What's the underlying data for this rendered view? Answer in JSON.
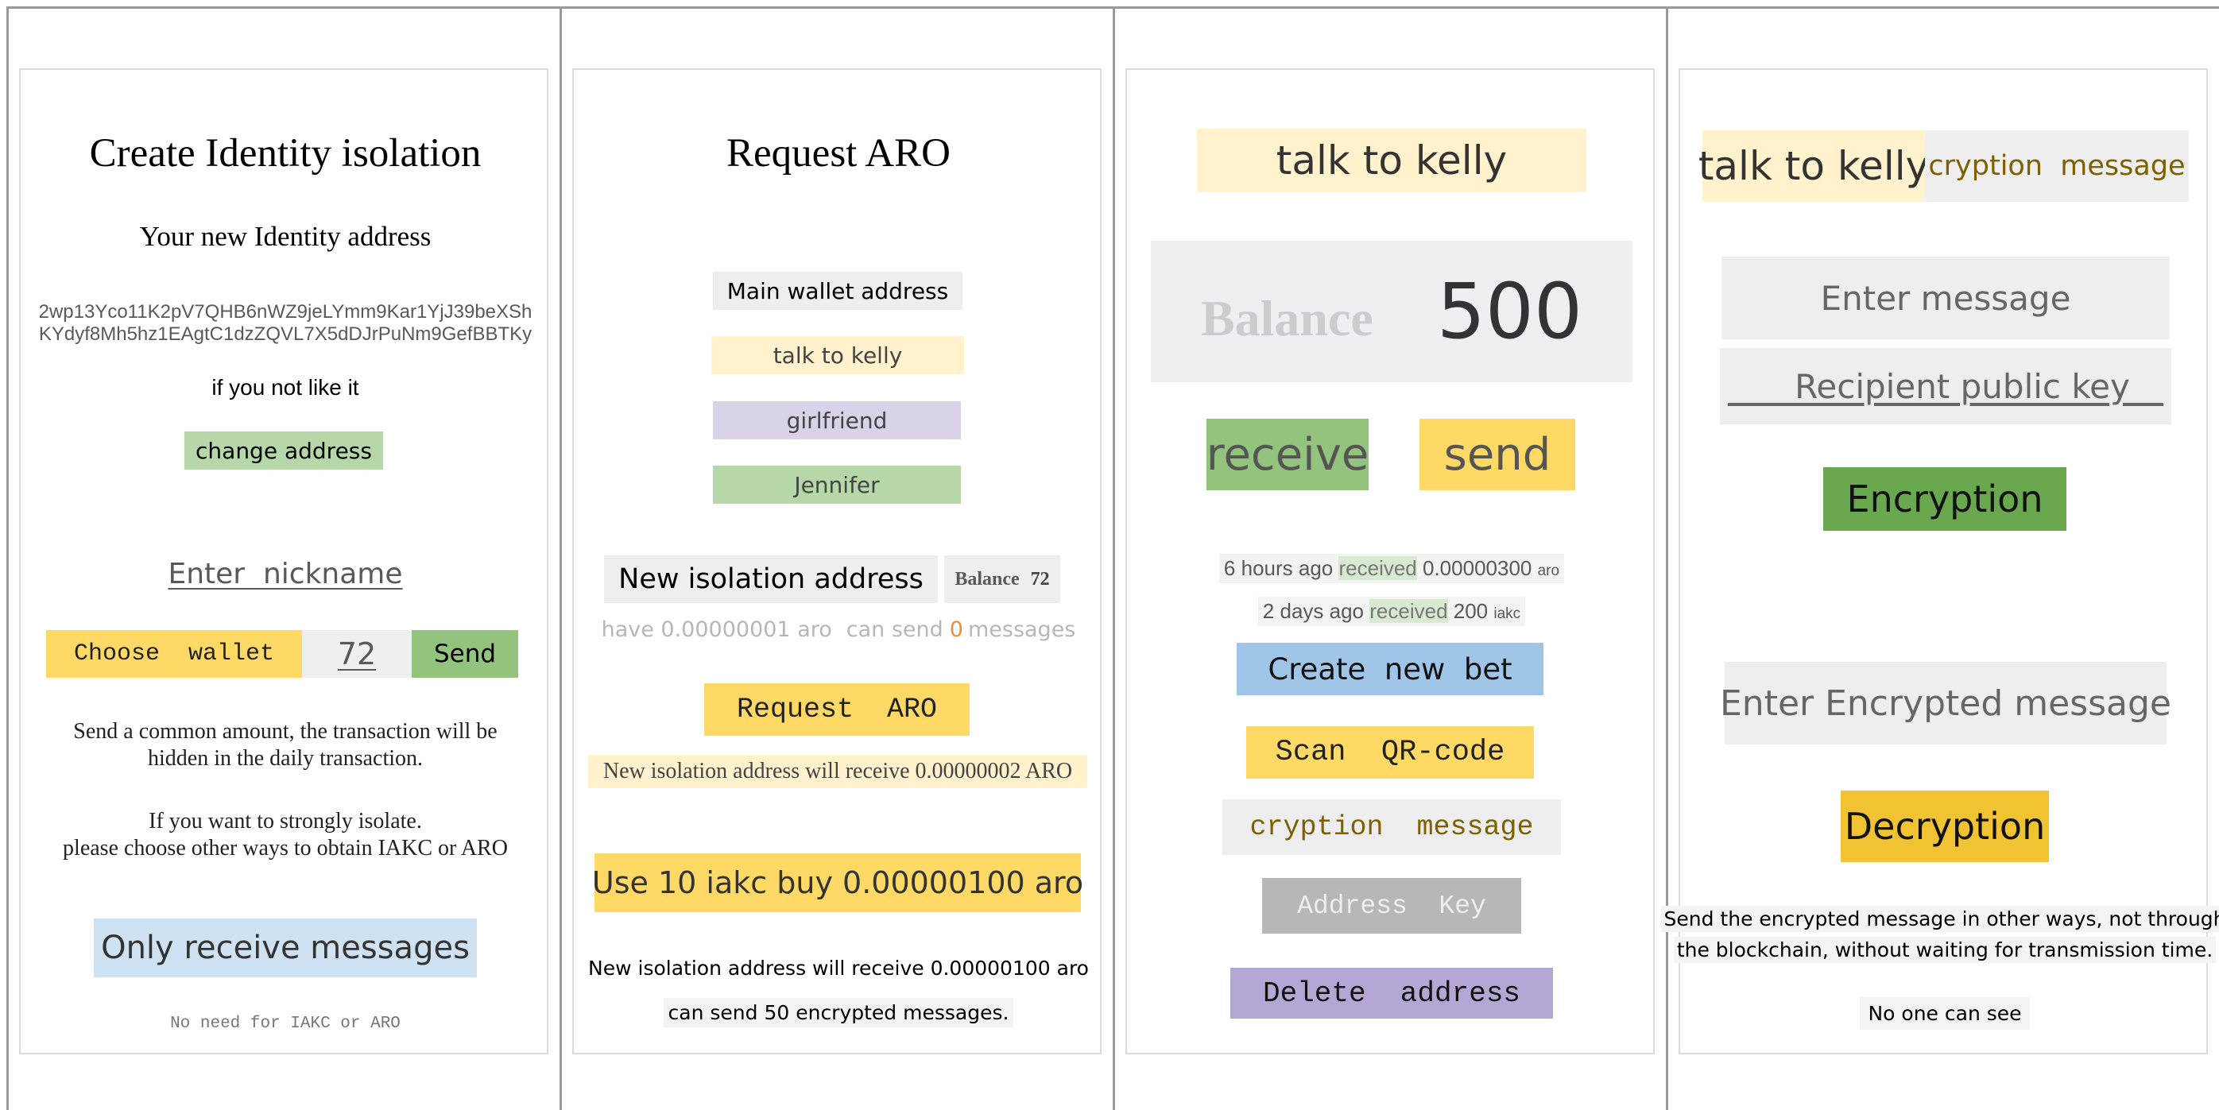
{
  "panel1": {
    "title": "Create Identity isolation",
    "subtitle": "Your new Identity address",
    "address_line1": "2wp13Yco11K2pV7QHB6nWZ9jeLYmm9Kar1YjJ39beXSh",
    "address_line2": "KYdyf8Mh5hz1EAgtC1dzZQVL7X5dDJrPuNm9GefBBTKy",
    "if_not_like": "if you not like it",
    "change_address": "change address",
    "nickname_placeholder": "Enter  nickname",
    "choose_wallet": "Choose  wallet",
    "amount": "72",
    "send": "Send",
    "note1_line1": "Send a common amount, the transaction will be",
    "note1_line2": "hidden in the daily transaction.",
    "note2_line1": "If you want to strongly isolate.",
    "note2_line2": "please choose other ways to obtain IAKC or ARO",
    "only_receive": "Only receive messages",
    "no_need": "No need for IAKC or ARO"
  },
  "panel2": {
    "title": "Request ARO",
    "wallets": [
      {
        "label": "Main wallet address"
      },
      {
        "label": "talk to kelly"
      },
      {
        "label": "girlfriend"
      },
      {
        "label": "Jennifer"
      }
    ],
    "new_isolation": "New isolation address",
    "balance_label": "Balance",
    "balance_value": "72",
    "have_text": "have 0.00000001 aro",
    "can_send_pre": "can send",
    "can_send_num": "0",
    "can_send_post": "messages",
    "request_button": "Request  ARO",
    "receive_note": "New isolation address will receive 0.00000002 ARO",
    "buy_button": "Use 10 iakc buy 0.00000100 aro",
    "bottom_line1": "New isolation address will receive 0.00000100 aro",
    "bottom_line2": "can send 50 encrypted messages."
  },
  "panel3": {
    "header": "talk to kelly",
    "balance_label": "Balance",
    "balance_value": "500",
    "receive": "receive",
    "send": "send",
    "tx1": {
      "time": "6 hours ago",
      "type": "received",
      "amount": "0.00000300",
      "unit": "aro"
    },
    "tx2": {
      "time": "2 days ago",
      "type": "received",
      "amount": "200",
      "unit": "iakc"
    },
    "create_bet": "Create  new  bet",
    "scan_qr": "Scan  QR-code",
    "cryption": "cryption  message",
    "address_key": "Address  Key",
    "delete_address": "Delete  address"
  },
  "panel4": {
    "tab_talk": "talk to kelly",
    "tab_cryption": "cryption  message",
    "enter_message": "Enter message",
    "recipient_key": "____Recipient public key__",
    "encryption": "Encryption",
    "enter_encrypted": "Enter Encrypted message",
    "decryption": "Decryption",
    "note_line1": "Send the encrypted message in other ways, not through",
    "note_line2": "the blockchain, without waiting for transmission time.",
    "no_one": "No one can see"
  },
  "colors": {
    "yellow": "#ffd966",
    "light_yellow": "#fff2cc",
    "green": "#b6d7a8",
    "dark_green": "#6aa84f",
    "purple": "#b4a7d6",
    "light_purple": "#d9d2e9",
    "blue": "#9fc5e8",
    "light_blue": "#cfe2f3",
    "gold": "#f1c232",
    "grey": "#eeeeee"
  }
}
